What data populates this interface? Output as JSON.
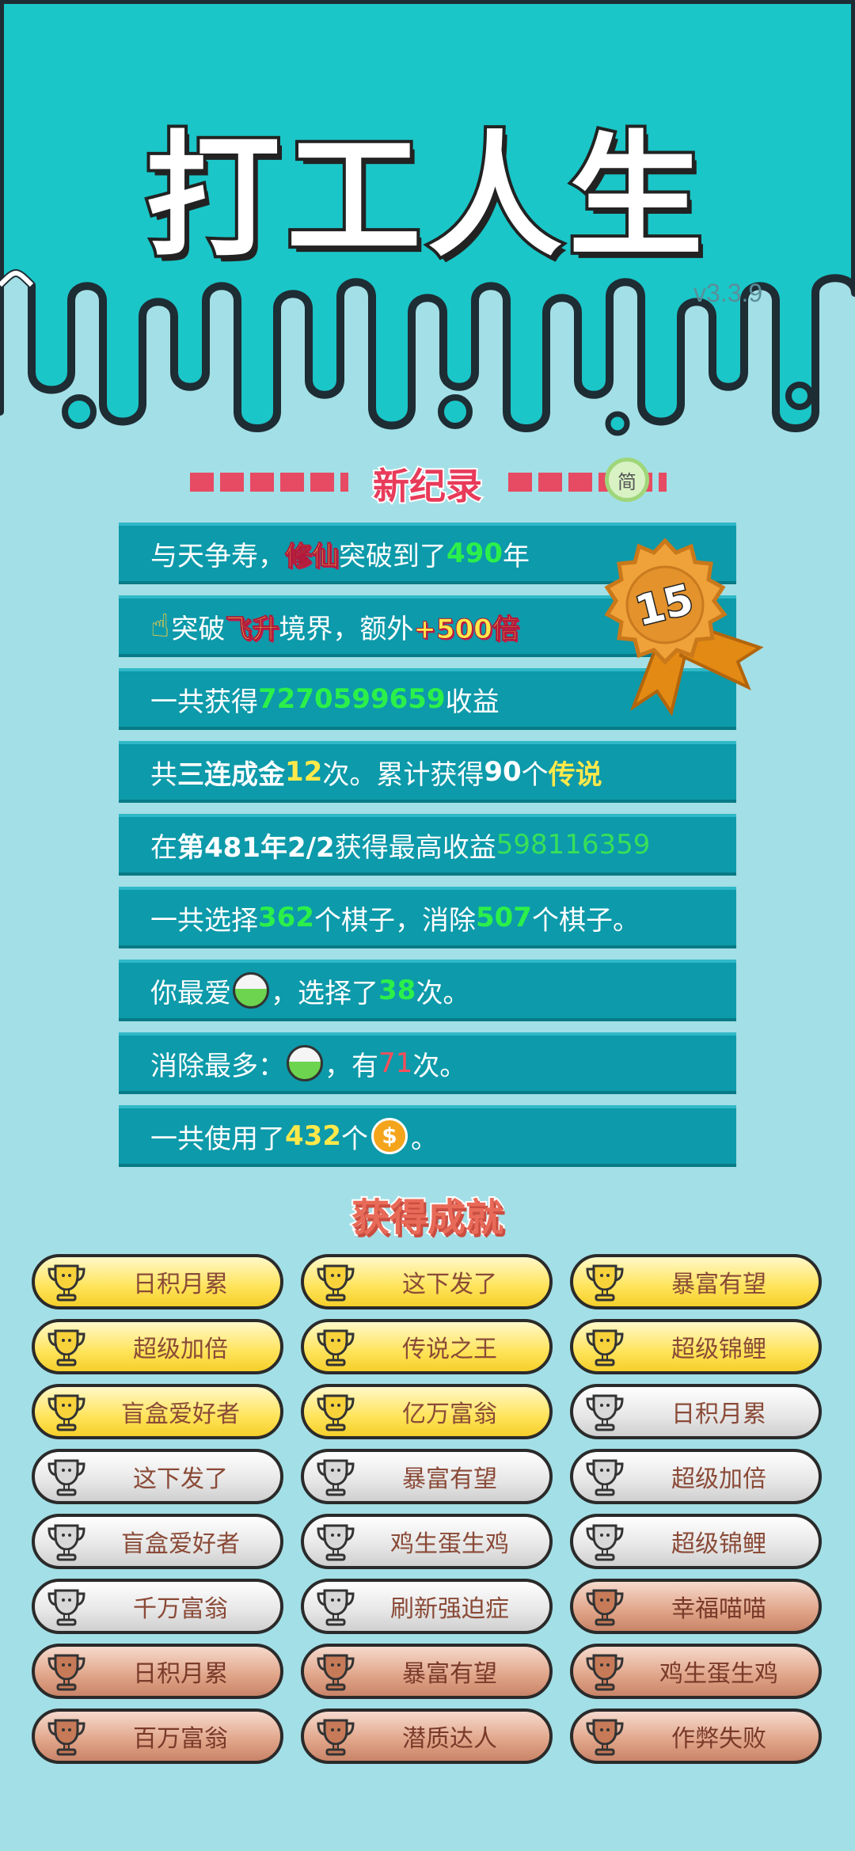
{
  "app": {
    "title": "打工人生",
    "version": "v3.3.9"
  },
  "record": {
    "title": "新纪录",
    "lang_button": "简",
    "medal_rank": "15"
  },
  "stats": {
    "row1": {
      "a": "与天争寿，",
      "b": "修仙",
      "c": "突破到了",
      "d": "490",
      "e": "年"
    },
    "row2": {
      "a": "突破",
      "b": "飞升",
      "c": "境界，额外",
      "d": "+500倍"
    },
    "row3": {
      "a": "一共获得",
      "b": "7270599659",
      "c": "收益"
    },
    "row4": {
      "a": "共",
      "b": "三连成金",
      "c": "12",
      "d": "次。累计获得",
      "e": "90",
      "f": "个",
      "g": "传说"
    },
    "row5": {
      "a": "在 ",
      "b": "第481年2/2",
      "c": " 获得最高收益",
      "d": "598116359"
    },
    "row6": {
      "a": "一共选择",
      "b": "362",
      "c": "个棋子，消除",
      "d": "507",
      "e": "个棋子。"
    },
    "row7": {
      "a": "你最爱",
      "b": "，选择了",
      "c": "38",
      "d": "次。"
    },
    "row8": {
      "a": "消除最多：",
      "b": "，有",
      "c": "71",
      "d": "次。"
    },
    "row9": {
      "a": "一共使用了",
      "b": "432",
      "c": "个",
      "coin": "$",
      "d": "。"
    }
  },
  "achievements": {
    "title": "获得成就",
    "items": [
      {
        "label": "日积月累",
        "tier": "gold"
      },
      {
        "label": "这下发了",
        "tier": "gold"
      },
      {
        "label": "暴富有望",
        "tier": "gold"
      },
      {
        "label": "超级加倍",
        "tier": "gold"
      },
      {
        "label": "传说之王",
        "tier": "gold"
      },
      {
        "label": "超级锦鲤",
        "tier": "gold"
      },
      {
        "label": "盲盒爱好者",
        "tier": "gold"
      },
      {
        "label": "亿万富翁",
        "tier": "gold"
      },
      {
        "label": "日积月累",
        "tier": "silver"
      },
      {
        "label": "这下发了",
        "tier": "silver"
      },
      {
        "label": "暴富有望",
        "tier": "silver"
      },
      {
        "label": "超级加倍",
        "tier": "silver"
      },
      {
        "label": "盲盒爱好者",
        "tier": "silver"
      },
      {
        "label": "鸡生蛋生鸡",
        "tier": "silver"
      },
      {
        "label": "超级锦鲤",
        "tier": "silver"
      },
      {
        "label": "千万富翁",
        "tier": "silver"
      },
      {
        "label": "刷新强迫症",
        "tier": "silver"
      },
      {
        "label": "幸福喵喵",
        "tier": "bronze"
      },
      {
        "label": "日积月累",
        "tier": "bronze"
      },
      {
        "label": "暴富有望",
        "tier": "bronze"
      },
      {
        "label": "鸡生蛋生鸡",
        "tier": "bronze"
      },
      {
        "label": "百万富翁",
        "tier": "bronze"
      },
      {
        "label": "潜质达人",
        "tier": "bronze"
      },
      {
        "label": "作弊失败",
        "tier": "bronze"
      }
    ]
  },
  "colors": {
    "teal": "#1ac6c8",
    "background": "#a3dfe6",
    "row": "#0d9aaa",
    "green_value": "#2cf04a",
    "yellow_value": "#ffe94a",
    "red_value": "#ff4d58",
    "record_red": "#e83b5a",
    "gold": "#ffe45a",
    "silver": "#e6e6e6",
    "bronze": "#e0a488"
  }
}
